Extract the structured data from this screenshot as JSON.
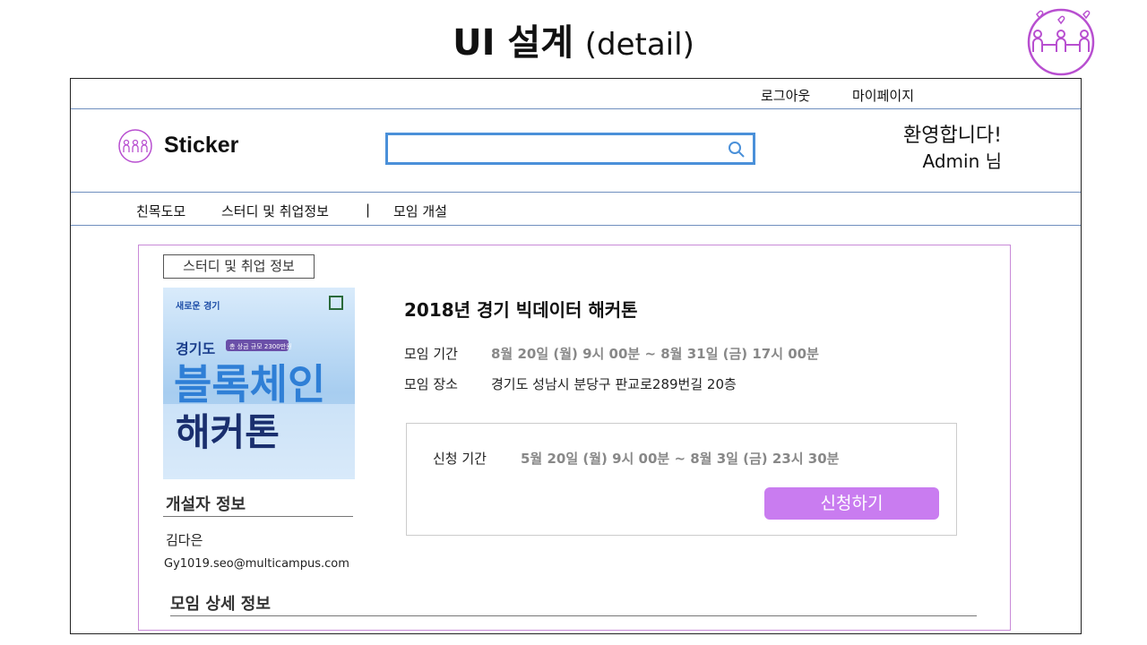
{
  "slide": {
    "title": "UI 설계",
    "subtitle": "(detail)"
  },
  "header": {
    "logout": "로그아웃",
    "mypage": "마이페이지",
    "brand": "Sticker",
    "search_placeholder": "",
    "welcome": "환영합니다!",
    "user": "Admin 님"
  },
  "nav": {
    "items": [
      "친목도모",
      "스터디 및 취업정보",
      "|",
      "모임 개설"
    ]
  },
  "event": {
    "category_tag": "스터디 및 취업 정보",
    "poster": {
      "top_left": "새로운 경기",
      "region": "경기도",
      "badge": "총 상금 규모 2300만원",
      "line1": "블록체인",
      "line2": "해커톤"
    },
    "title": "2018년 경기 빅데이터 해커톤",
    "period_label": "모임 기간",
    "period_value": "8월 20일 (월) 9시 00분 ~ 8월 31일 (금) 17시 00분",
    "place_label": "모임 장소",
    "place_value": "경기도 성남시 분당구 판교로289번길 20층",
    "apply_label": "신청 기간",
    "apply_value": "5월 20일 (월) 9시 00분 ~ 8월 3일 (금) 23시 30분",
    "apply_button": "신청하기",
    "creator_heading": "개설자 정보",
    "creator_name": "김다은",
    "creator_email": "Gy1019.seo@multicampus.com",
    "detail_heading": "모임 상세 정보"
  },
  "colors": {
    "accent": "#c97cf0",
    "search_border": "#4a90d9",
    "content_border": "#c98ad8",
    "logo": "#b84fd0"
  }
}
